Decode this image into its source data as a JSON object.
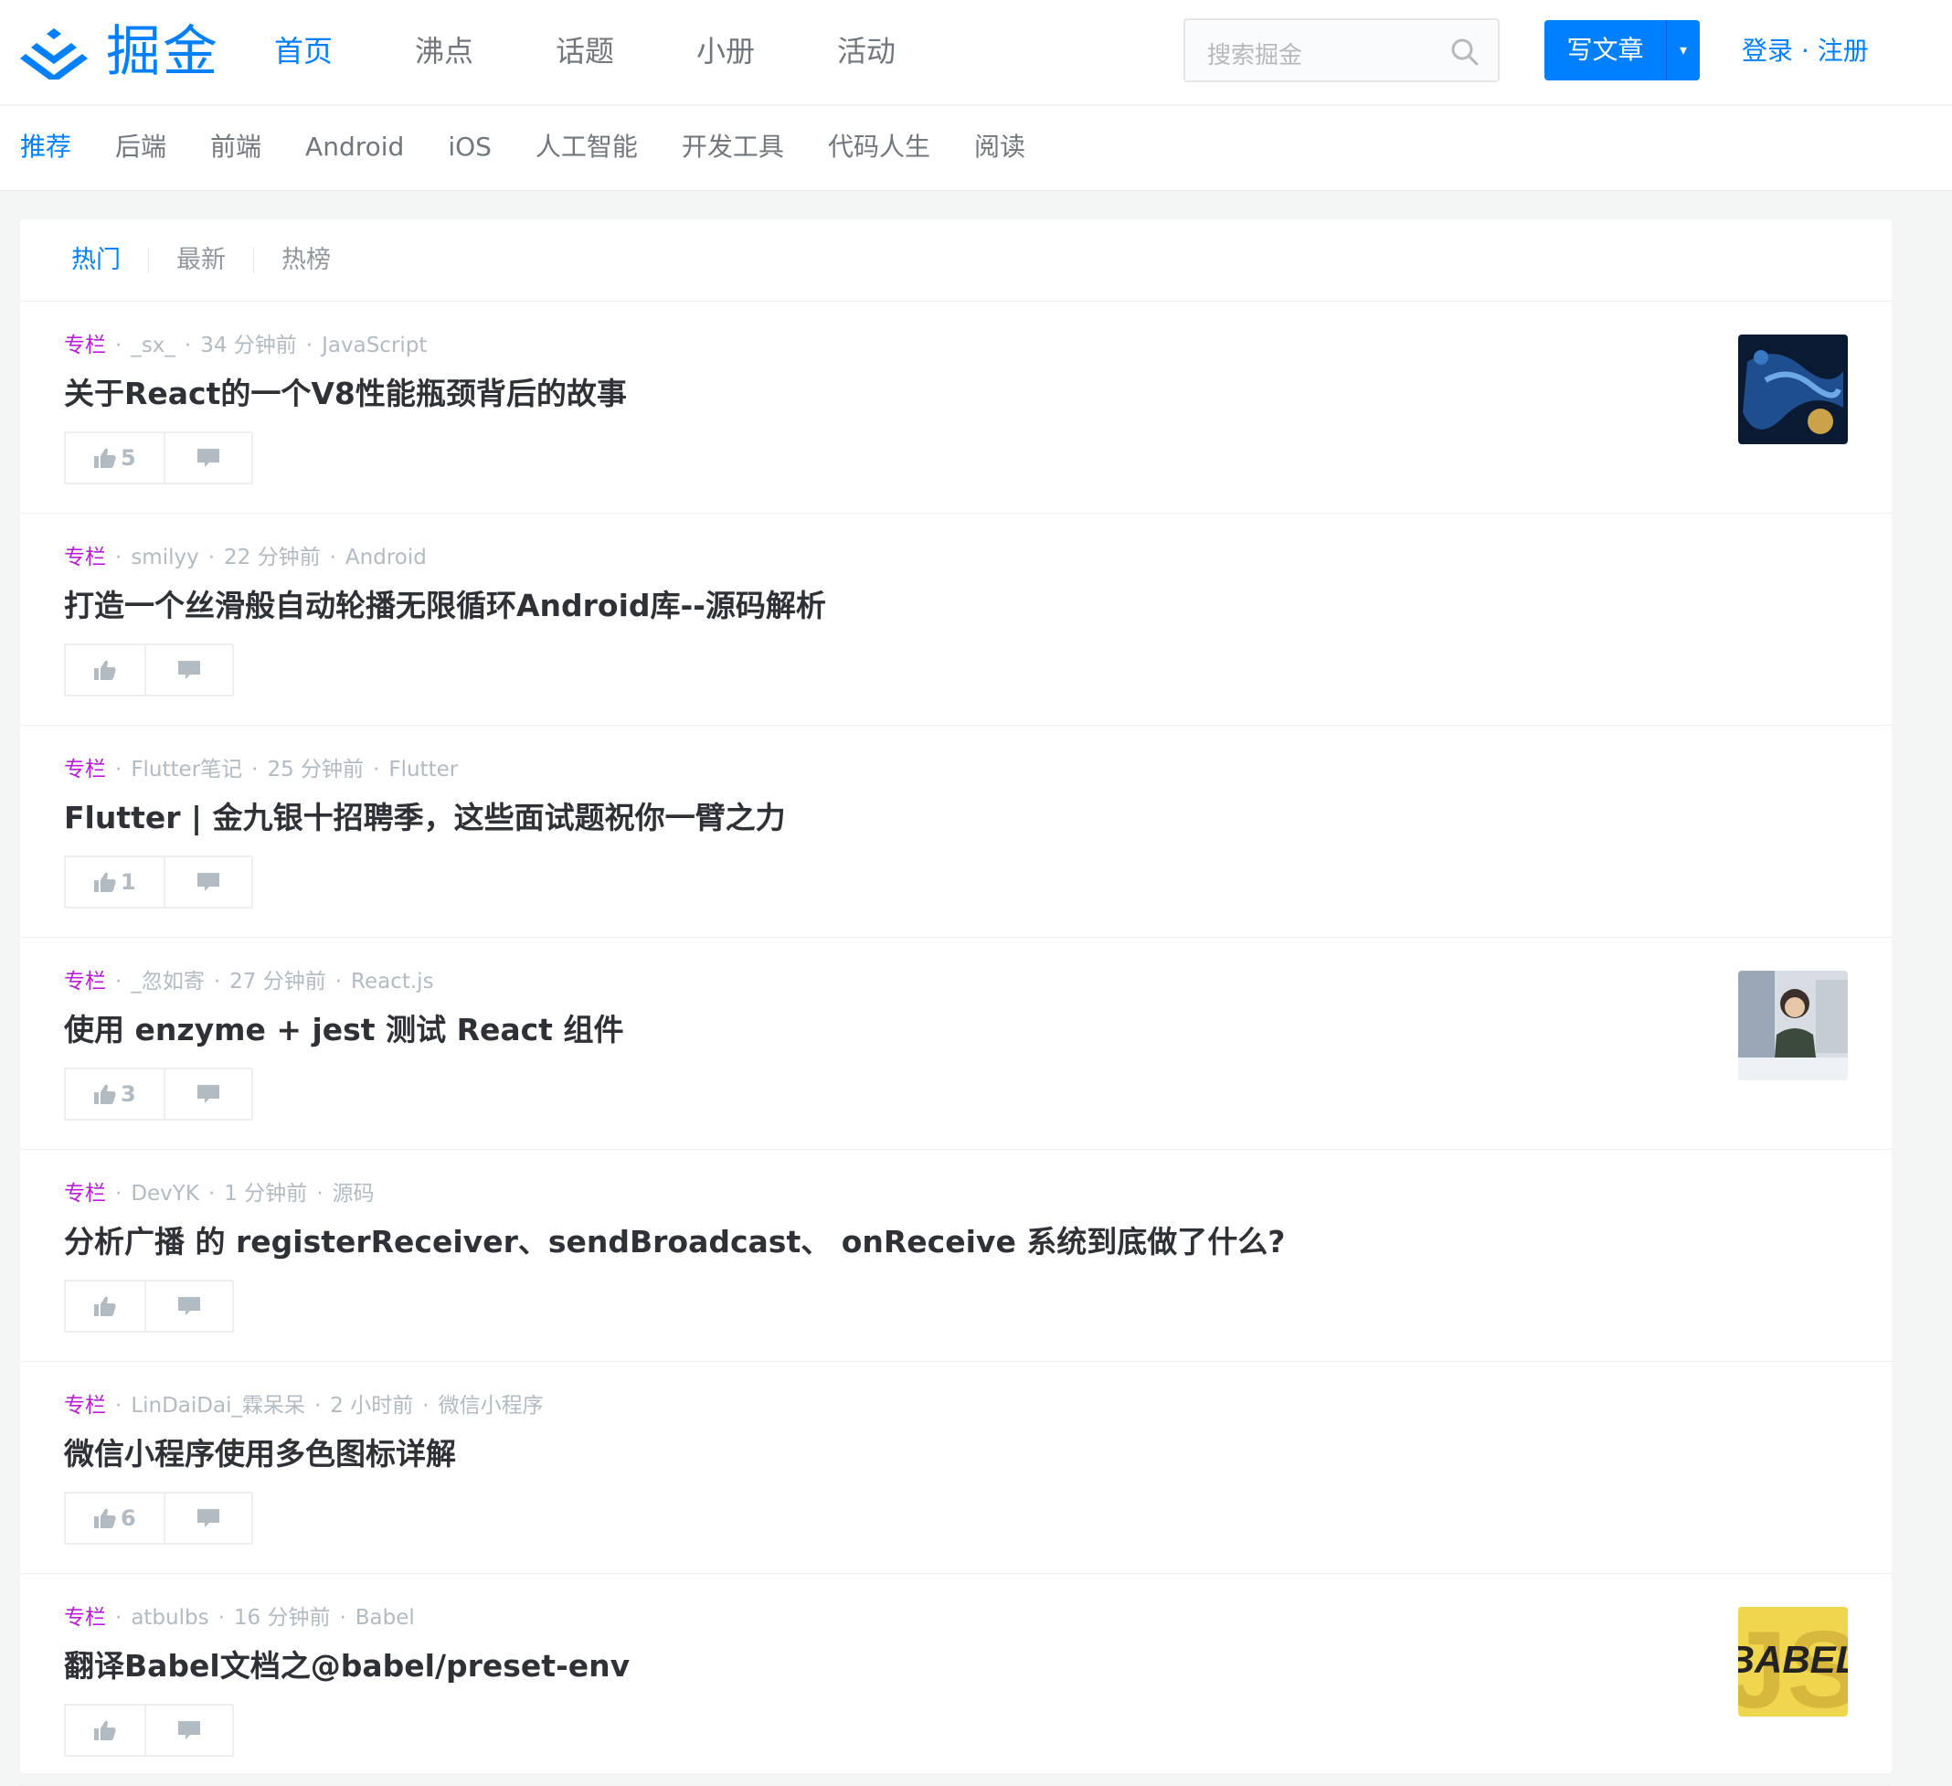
{
  "header": {
    "logo_text": "掘金",
    "nav": [
      {
        "label": "首页",
        "active": true
      },
      {
        "label": "沸点"
      },
      {
        "label": "话题"
      },
      {
        "label": "小册"
      },
      {
        "label": "活动"
      }
    ],
    "search_placeholder": "搜索掘金",
    "write_label": "写文章",
    "write_caret": "▾",
    "auth": "登录 · 注册"
  },
  "subnav": [
    "推荐",
    "后端",
    "前端",
    "Android",
    "iOS",
    "人工智能",
    "开发工具",
    "代码人生",
    "阅读"
  ],
  "tabs": [
    "热门",
    "最新",
    "热榜"
  ],
  "entries": [
    {
      "type": "专栏",
      "author": "_sx_",
      "time": "34 分钟前",
      "tag": "JavaScript",
      "title": "关于React的一个V8性能瓶颈背后的故事",
      "likes": "5",
      "thumb": "dark-blue"
    },
    {
      "type": "专栏",
      "author": "smilyy",
      "time": "22 分钟前",
      "tag": "Android",
      "title": "打造一个丝滑般自动轮播无限循环Android库--源码解析",
      "likes": "",
      "thumb": ""
    },
    {
      "type": "专栏",
      "author": "Flutter笔记",
      "time": "25 分钟前",
      "tag": "Flutter",
      "title": "Flutter | 金九银十招聘季，这些面试题祝你一臂之力",
      "likes": "1",
      "thumb": ""
    },
    {
      "type": "专栏",
      "author": "_忽如寄",
      "time": "27 分钟前",
      "tag": "React.js",
      "title": "使用 enzyme + jest 测试 React 组件",
      "likes": "3",
      "thumb": "portrait"
    },
    {
      "type": "专栏",
      "author": "DevYK",
      "time": "1 分钟前",
      "tag": "源码",
      "title": "分析广播 的 registerReceiver、sendBroadcast、 onReceive 系统到底做了什么?",
      "likes": "",
      "thumb": ""
    },
    {
      "type": "专栏",
      "author": "LinDaiDai_霖呆呆",
      "time": "2 小时前",
      "tag": "微信小程序",
      "title": "微信小程序使用多色图标详解",
      "likes": "6",
      "thumb": ""
    },
    {
      "type": "专栏",
      "author": "atbulbs",
      "time": "16 分钟前",
      "tag": "Babel",
      "title": "翻译Babel文档之@babel/preset-env",
      "likes": "",
      "thumb": "babel"
    }
  ],
  "thumb_text": "BABEL",
  "colors": {
    "brand": "#007fff",
    "column": "#b71ed7"
  }
}
